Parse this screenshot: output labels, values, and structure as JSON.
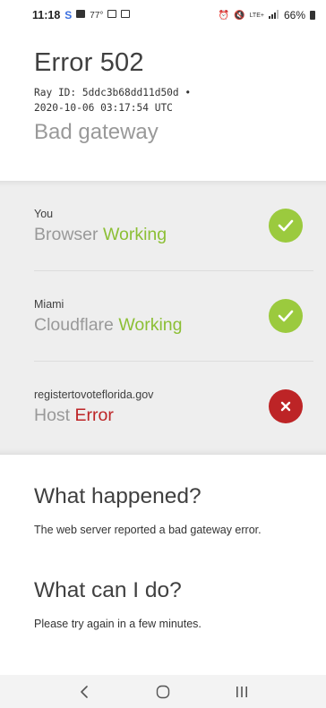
{
  "status_bar": {
    "time": "11:18",
    "temp": "77°",
    "signal": "LTE+",
    "battery": "66%"
  },
  "error": {
    "title": "Error 502",
    "ray_id_line": "Ray ID: 5ddc3b68dd11d50d •",
    "timestamp": "2020-10-06 03:17:54 UTC",
    "subtitle": "Bad gateway"
  },
  "status_items": [
    {
      "location": "You",
      "kind": "Browser",
      "state": "Working",
      "status": "ok"
    },
    {
      "location": "Miami",
      "kind": "Cloudflare",
      "state": "Working",
      "status": "ok"
    },
    {
      "location": "registertovoteflorida.gov",
      "kind": "Host",
      "state": "Error",
      "status": "error"
    }
  ],
  "what_happened": {
    "heading": "What happened?",
    "body": "The web server reported a bad gateway error."
  },
  "what_can_i_do": {
    "heading": "What can I do?",
    "body": "Please try again in a few minutes."
  },
  "colors": {
    "ok": "#9bca3e",
    "error": "#bd2426"
  },
  "nav_icons": [
    "back-icon",
    "home-icon",
    "recent-apps-icon"
  ]
}
